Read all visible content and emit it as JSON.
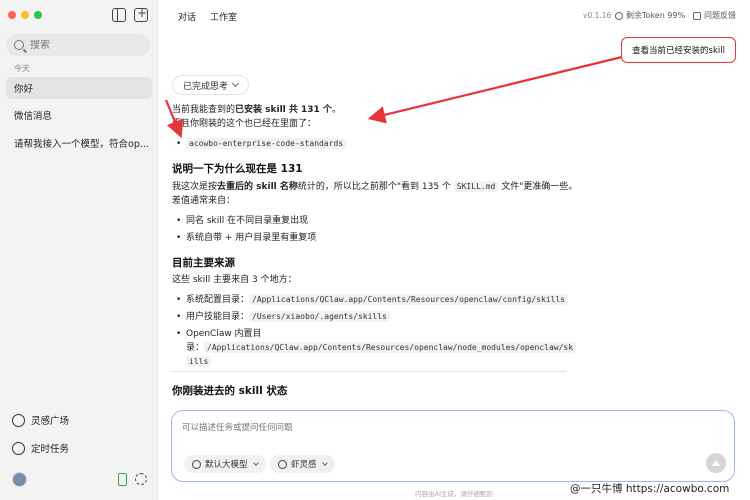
{
  "sidebar": {
    "search_placeholder": "搜索",
    "section_today": "今天",
    "chats": [
      "你好",
      "微信消息",
      "请帮我接入一个模型，符合op..."
    ],
    "bottom": {
      "inspiration": "灵感广场",
      "scheduled": "定时任务"
    }
  },
  "header": {
    "tab_chat": "对话",
    "tab_studio": "工作室",
    "version": "v0.1.16",
    "token": "剩余Token 99%",
    "feedback": "问题反馈"
  },
  "callout": "查看当前已经安装的skill",
  "main": {
    "thinking_label": "已完成思考",
    "p1_pre": "当前我能查到的",
    "p1_bold": "已安装 skill 共 131 个",
    "p1_post": "。",
    "p2": "而且你刚装的这个也已经在里面了：",
    "installed_skill": "acowbo-enterprise-code-standards",
    "h_why": "说明一下为什么现在是 131",
    "p3_pre": "我这次是按",
    "p3_bold": "去重后的 skill 名称",
    "p3_mid": "统计的，所以比之前那个\"看到 135 个 ",
    "p3_code": "SKILL.md",
    "p3_post": " 文件\"更准确一些。",
    "p4": "差值通常来自：",
    "reasons": [
      "同名 skill 在不同目录重复出现",
      "系统自带 + 用户目录里有重复项"
    ],
    "h_sources": "目前主要来源",
    "p5": "这些 skill 主要来自 3 个地方：",
    "sources": [
      {
        "label": "系统配置目录：",
        "path": "/Applications/QClaw.app/Contents/Resources/openclaw/config/skills"
      },
      {
        "label": "用户技能目录：",
        "path": "/Users/xiaobo/.agents/skills"
      },
      {
        "label": "OpenClaw 内置目",
        "label2": "录：",
        "path": "/Applications/QClaw.app/Contents/Resources/openclaw/node_modules/openclaw/sk",
        "path2": "ills"
      }
    ],
    "h_status": "你刚装进去的 skill 状态"
  },
  "composer": {
    "placeholder": "可以描述任务或提问任何问题",
    "model_chip": "默认大模型",
    "inspiration_chip": "虾灵感"
  },
  "disclaimer": "内容由AI生成，请仔细甄别",
  "watermark": "@一只牛博 https://acowbo.com",
  "colors": {
    "accent_red": "#e5343a",
    "composer_border": "#9fb7ea"
  }
}
